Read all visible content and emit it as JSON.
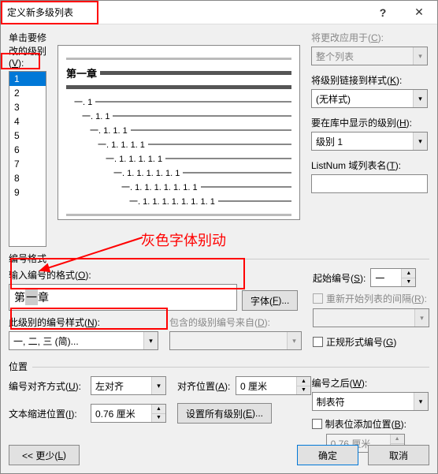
{
  "titlebar": {
    "title": "定义新多级列表",
    "help": "?",
    "close": "✕"
  },
  "top": {
    "click_label_pre": "单击要修改的级别(",
    "click_label_key": "V",
    "click_label_post": "):",
    "levels": [
      "1",
      "2",
      "3",
      "4",
      "5",
      "6",
      "7",
      "8",
      "9"
    ],
    "selected_level": "1",
    "apply_label_pre": "将更改应用于(",
    "apply_label_key": "C",
    "apply_label_post": "):",
    "apply_value": "整个列表",
    "link_label_pre": "将级别链接到样式(",
    "link_label_key": "K",
    "link_label_post": "):",
    "link_value": "(无样式)",
    "gallery_label_pre": "要在库中显示的级别(",
    "gallery_label_key": "H",
    "gallery_label_post": "):",
    "gallery_value": "级别 1",
    "listnum_label_pre": "ListNum 域列表名(",
    "listnum_label_key": "T",
    "listnum_label_post": "):",
    "listnum_value": ""
  },
  "preview": {
    "r1": "第一章",
    "r2": "一. 1",
    "r3": "一. 1. 1",
    "r4": "一. 1. 1. 1",
    "r5": "一. 1. 1. 1. 1",
    "r6": "一. 1. 1. 1. 1. 1",
    "r7": "一. 1. 1. 1. 1. 1. 1",
    "r8": "一. 1. 1. 1. 1. 1. 1. 1",
    "r9": "一. 1. 1. 1. 1. 1. 1. 1. 1"
  },
  "numfmt": {
    "section": "编号格式",
    "input_label": "输入编号的格式",
    "value_pre": "第",
    "value_gray": "一",
    "value_post": "章",
    "font_btn_pre": "字体(",
    "font_btn_key": "F",
    "font_btn_post": ")...",
    "style_label_pre": "此级别的编号样式(",
    "style_label_key": "N",
    "style_label_post": "):",
    "style_value": "一, 二, 三 (简)...",
    "include_label_pre": "包含的级别编号来自(",
    "include_label_key": "D",
    "include_label_post": "):",
    "include_value": "",
    "start_label_pre": "起始编号(",
    "start_label_key": "S",
    "start_label_post": "):",
    "start_value": "一",
    "restart_label_pre": "重新开始列表的间隔(",
    "restart_label_key": "R",
    "restart_label_post": "):",
    "restart_value": "",
    "legal_label_pre": "正规形式编号(",
    "legal_label_key": "G",
    "legal_label_post": ")"
  },
  "pos": {
    "section": "位置",
    "align_label_pre": "编号对齐方式(",
    "align_label_key": "U",
    "align_label_post": "):",
    "align_value": "左对齐",
    "alignat_label_pre": "对齐位置(",
    "alignat_label_key": "A",
    "alignat_label_post": "):",
    "alignat_value": "0 厘米",
    "indent_label_pre": "文本缩进位置(",
    "indent_label_key": "I",
    "indent_label_post": "):",
    "indent_value": "0.76 厘米",
    "setall_btn_pre": "设置所有级别(",
    "setall_btn_key": "E",
    "setall_btn_post": ")...",
    "after_label_pre": "编号之后(",
    "after_label_key": "W",
    "after_label_post": "):",
    "after_value": "制表符",
    "tabstop_label_pre": "制表位添加位置(",
    "tabstop_label_key": "B",
    "tabstop_label_post": "):",
    "tabstop_value": "0.76 厘米"
  },
  "footer": {
    "less_pre": "<< 更少(",
    "less_key": "L",
    "less_post": ")",
    "ok": "确定",
    "cancel": "取消"
  },
  "annotation": {
    "gray_note": "灰色字体别动"
  }
}
